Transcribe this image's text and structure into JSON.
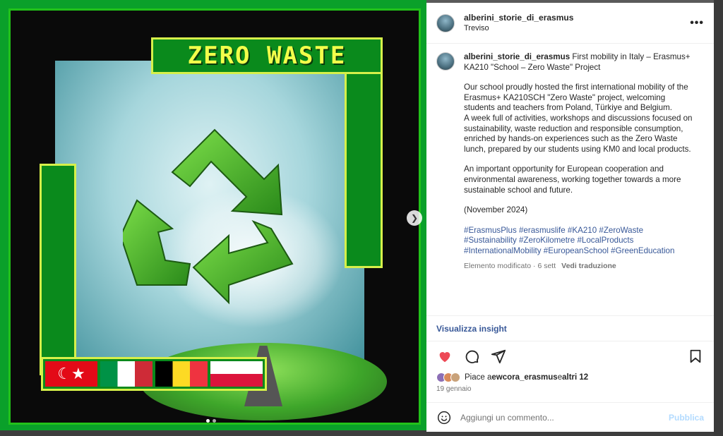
{
  "post": {
    "username": "alberini_storie_di_erasmus",
    "location": "Treviso",
    "more_label": "•••",
    "caption_user": "alberini_storie_di_erasmus",
    "caption_title": "First mobility in Italy – Erasmus+ KA210 \"School – Zero Waste\" Project",
    "paragraph1": "Our school proudly hosted the first international mobility of the Erasmus+ KA210SCH \"Zero Waste\" project, welcoming students and teachers from Poland, Türkiye and Belgium.",
    "paragraph2": "A week full of activities, workshops and discussions focused on sustainability, waste reduction and responsible consumption, enriched by hands-on experiences such as the Zero Waste lunch, prepared by our students using KM0 and local products.",
    "paragraph3": "An important opportunity for European cooperation and environmental awareness, working together towards a more sustainable school and future.",
    "date_note": "(November 2024)",
    "hashtags": "#ErasmusPlus #erasmuslife #KA210 #ZeroWaste #Sustainability #ZeroKilometre #LocalProducts #InternationalMobility #EuropeanSchool #GreenEducation",
    "edited": "Elemento modificato · 6 sett",
    "translate": "Vedi traduzione",
    "insight": "Visualizza insight",
    "likes_prefix": "Piace a ",
    "likes_user": "ewcora_erasmus",
    "likes_mid": " e ",
    "likes_others": "altri 12",
    "post_date": "19 gennaio",
    "comment_placeholder": "Aggiungi un commento...",
    "publish": "Pubblica",
    "liked": true
  },
  "image": {
    "title": "ZERO WASTE",
    "carousel": {
      "current": 1,
      "total": 2
    }
  },
  "colors": {
    "heart": "#ed4956",
    "link": "#385898",
    "poster_green": "#0a8a1c",
    "title_yellow": "#f2ff4a"
  }
}
